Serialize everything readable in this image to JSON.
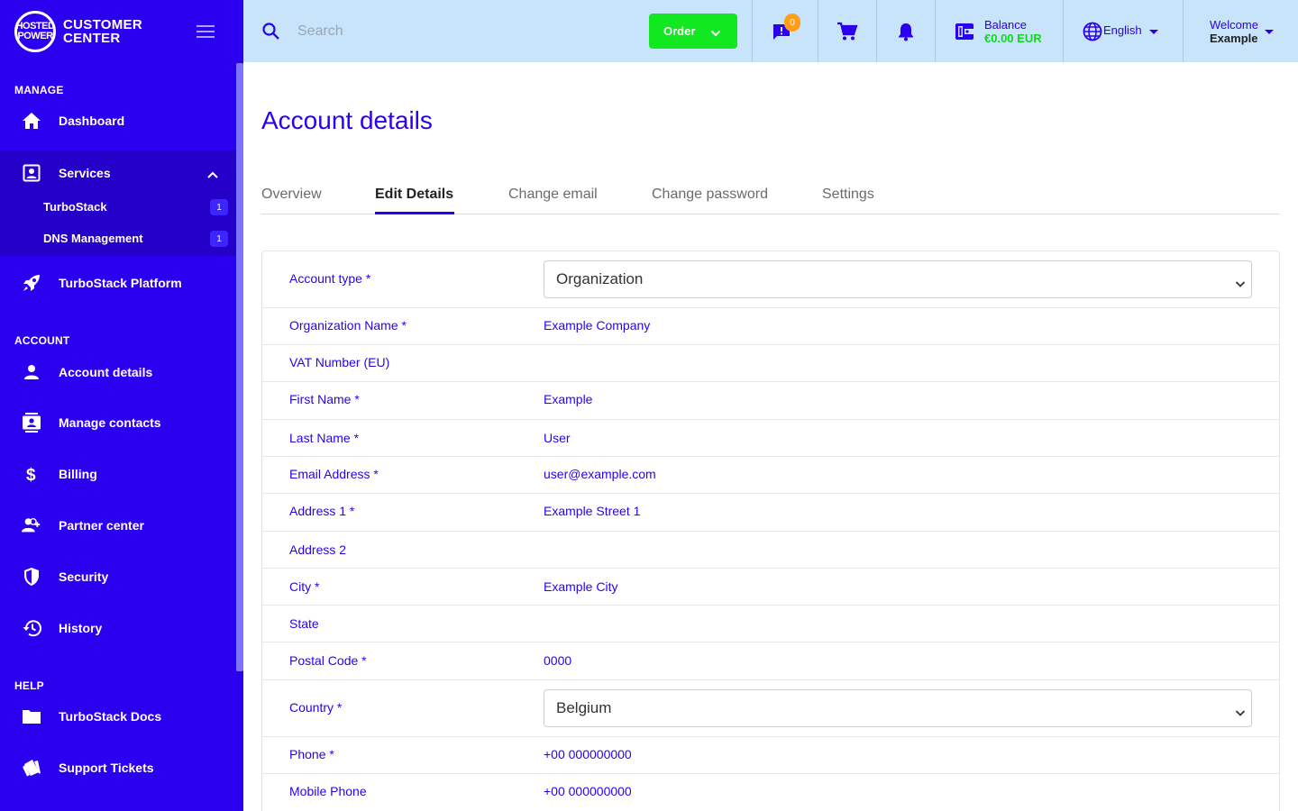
{
  "brand": {
    "badge_line1": "HOSTED",
    "badge_line2": "POWER",
    "title_line1": "CUSTOMER",
    "title_line2": "CENTER"
  },
  "sidebar": {
    "sections": {
      "manage": "MANAGE",
      "account": "ACCOUNT",
      "help": "HELP"
    },
    "items": {
      "dashboard": "Dashboard",
      "services": "Services",
      "turbostack": "TurboStack",
      "turbostack_count": "1",
      "dns": "DNS Management",
      "dns_count": "1",
      "turbostack_platform": "TurboStack Platform",
      "account_details": "Account details",
      "manage_contacts": "Manage contacts",
      "billing": "Billing",
      "partner_center": "Partner center",
      "security": "Security",
      "history": "History",
      "docs": "TurboStack Docs",
      "support": "Support Tickets"
    }
  },
  "topbar": {
    "search_placeholder": "Search",
    "order_label": "Order",
    "messages_count": "0",
    "balance_label": "Balance",
    "balance_value": "€0.00 EUR",
    "language": "English",
    "welcome_label": "Welcome",
    "welcome_name": "Example"
  },
  "page": {
    "title": "Account details",
    "tabs": {
      "overview": "Overview",
      "edit": "Edit Details",
      "email": "Change email",
      "password": "Change password",
      "settings": "Settings"
    }
  },
  "form": {
    "account_type": {
      "label": "Account type *",
      "value": "Organization"
    },
    "org_name": {
      "label": "Organization Name *",
      "value": "Example Company"
    },
    "vat": {
      "label": "VAT Number (EU)",
      "value": ""
    },
    "first_name": {
      "label": "First Name *",
      "value": "Example"
    },
    "last_name": {
      "label": "Last Name *",
      "value": "User"
    },
    "email": {
      "label": "Email Address *",
      "value": "user@example.com"
    },
    "address1": {
      "label": "Address 1 *",
      "value": "Example Street 1"
    },
    "address2": {
      "label": "Address 2",
      "value": ""
    },
    "city": {
      "label": "City *",
      "value": "Example City"
    },
    "state": {
      "label": "State",
      "value": ""
    },
    "postal": {
      "label": "Postal Code *",
      "value": "0000"
    },
    "country": {
      "label": "Country *",
      "value": "Belgium"
    },
    "phone": {
      "label": "Phone *",
      "value": "+00 000000000"
    },
    "mobile": {
      "label": "Mobile Phone",
      "value": "+00 000000000"
    }
  },
  "colors": {
    "sidebar_bg": "#2b00ee",
    "topbar_bg": "#c7e4fb",
    "accent": "#2b00ee",
    "order_green": "#11e81f",
    "badge_orange": "#ff9f19"
  }
}
